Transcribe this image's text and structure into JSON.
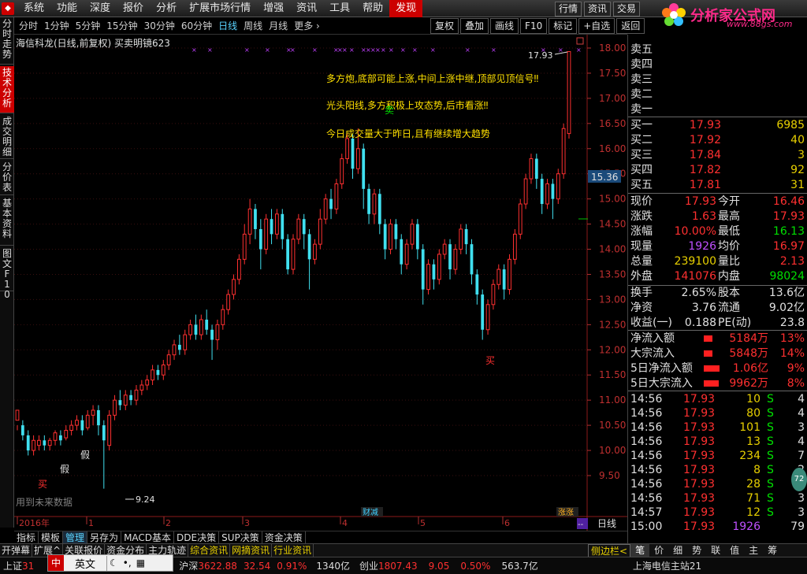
{
  "menu": {
    "items": [
      "系统",
      "功能",
      "深度",
      "报价",
      "分析",
      "扩展市场行情",
      "增强",
      "资讯",
      "工具",
      "帮助",
      "发现"
    ],
    "right_buttons": [
      "行情",
      "资讯",
      "交易"
    ]
  },
  "brand": {
    "name": "分析家公式网",
    "url": "www.88gs.com",
    "colors": {
      "accent": "#ff2a8a"
    }
  },
  "left_tabs": [
    "分时走势",
    "技术分析",
    "成交明细",
    "分价表",
    "基本资料",
    "图文F10"
  ],
  "chart_toolbar": {
    "periods": [
      "分时",
      "1分钟",
      "5分钟",
      "15分钟",
      "30分钟",
      "60分钟",
      "日线",
      "周线",
      "月线",
      "更多 ›"
    ],
    "tools": [
      "复权",
      "叠加",
      "画线",
      "F10",
      "标记",
      "+自选",
      "返回"
    ]
  },
  "chart_title": "海信科龙(日线,前复权) 买卖明镜623",
  "annotations": [
    "多方炮,底部可能上涨,中间上涨中继,顶部见顶信号‼",
    "光头阳线,多方积极上攻态势,后市看涨‼",
    "今日成交量大于昨日,且有继续增大趋势"
  ],
  "markers": {
    "buy": "买",
    "sell": "卖",
    "fake": "假",
    "cut": "财减",
    "limit": "涨涨",
    "hint": "用到未来数据",
    "low_label": "9.24",
    "high_label": "17.93",
    "cursor_price": "15.36",
    "period_label": "日线",
    "nav_minus": "--",
    "nav_plus": "+",
    "nav_minus2": "-",
    "nav_zero": "0"
  },
  "chart_data": {
    "type": "candlestick",
    "ylim": [
      9.24,
      18.0
    ],
    "y_ticks": [
      "18.00",
      "17.50",
      "17.00",
      "16.50",
      "16.00",
      "15.50",
      "15.00",
      "14.50",
      "14.00",
      "13.50",
      "13.00",
      "12.50",
      "12.00",
      "11.50",
      "11.00",
      "10.50",
      "10.00",
      "9.50"
    ],
    "x_ticks": [
      "2016年",
      "1",
      "2",
      "3",
      "4",
      "5",
      "6"
    ],
    "candles": [
      [
        10.6,
        10.8,
        10.5,
        10.4,
        10.9
      ],
      [
        10.5,
        10.3,
        10.2,
        10.6,
        10.4
      ],
      [
        10.3,
        10.0,
        9.9,
        10.4,
        9.95
      ],
      [
        10.0,
        10.2,
        9.9,
        10.3,
        10.1
      ],
      [
        10.1,
        10.2,
        10.0,
        10.3,
        10.15
      ],
      [
        10.2,
        10.1,
        10.0,
        10.3,
        10.05
      ],
      [
        10.1,
        10.2,
        10.0,
        10.25,
        10.15
      ],
      [
        10.2,
        10.35,
        10.1,
        10.4,
        10.3
      ],
      [
        10.3,
        10.2,
        10.1,
        10.4,
        10.25
      ],
      [
        10.25,
        10.4,
        10.2,
        10.5,
        10.35
      ],
      [
        10.4,
        10.5,
        10.3,
        10.6,
        10.45
      ],
      [
        10.5,
        10.6,
        10.4,
        10.7,
        10.55
      ],
      [
        10.6,
        10.4,
        10.3,
        10.7,
        10.45
      ],
      [
        10.45,
        10.7,
        10.4,
        10.8,
        10.6
      ],
      [
        10.7,
        10.8,
        10.5,
        10.9,
        10.7
      ],
      [
        10.8,
        10.5,
        10.3,
        10.9,
        10.4
      ],
      [
        10.5,
        10.2,
        9.24,
        10.6,
        10.3
      ],
      [
        10.1,
        10.7,
        10.0,
        10.8,
        10.6
      ],
      [
        10.7,
        11.0,
        10.6,
        11.1,
        10.9
      ],
      [
        11.0,
        10.9,
        10.8,
        11.2,
        10.95
      ],
      [
        10.9,
        11.1,
        10.8,
        11.2,
        11.05
      ],
      [
        11.1,
        11.0,
        10.9,
        11.2,
        11.05
      ],
      [
        11.0,
        11.2,
        10.9,
        11.3,
        11.1
      ],
      [
        11.2,
        11.3,
        11.1,
        11.4,
        11.25
      ],
      [
        11.3,
        11.4,
        11.2,
        11.5,
        11.35
      ],
      [
        11.4,
        11.6,
        11.3,
        11.7,
        11.5
      ],
      [
        11.6,
        11.5,
        11.4,
        11.7,
        11.55
      ],
      [
        11.5,
        11.7,
        11.4,
        11.8,
        11.65
      ],
      [
        11.7,
        11.9,
        11.6,
        12.0,
        11.8
      ],
      [
        11.9,
        12.1,
        11.8,
        12.2,
        12.0
      ],
      [
        12.1,
        12.0,
        11.9,
        12.3,
        12.05
      ],
      [
        12.0,
        12.3,
        11.9,
        12.4,
        12.2
      ],
      [
        12.3,
        12.5,
        12.2,
        12.6,
        12.4
      ],
      [
        12.5,
        12.3,
        12.2,
        12.7,
        12.4
      ],
      [
        12.3,
        12.6,
        12.2,
        12.7,
        12.5
      ],
      [
        12.6,
        12.4,
        12.3,
        12.8,
        12.5
      ],
      [
        12.4,
        12.2,
        11.8,
        12.5,
        12.1
      ],
      [
        12.2,
        12.5,
        12.0,
        12.6,
        12.4
      ],
      [
        12.5,
        12.8,
        12.4,
        12.9,
        12.7
      ],
      [
        12.8,
        13.1,
        12.7,
        13.2,
        13.0
      ],
      [
        13.1,
        13.4,
        13.0,
        13.5,
        13.3
      ],
      [
        13.4,
        13.8,
        13.3,
        13.9,
        13.6
      ],
      [
        13.8,
        14.3,
        13.7,
        14.5,
        14.1
      ],
      [
        14.3,
        14.8,
        14.1,
        15.0,
        14.6
      ],
      [
        14.8,
        14.4,
        14.2,
        14.9,
        14.5
      ],
      [
        14.4,
        14.0,
        13.6,
        14.6,
        13.8
      ],
      [
        14.0,
        14.6,
        13.9,
        14.7,
        14.4
      ],
      [
        14.6,
        14.3,
        14.1,
        14.8,
        14.4
      ],
      [
        14.3,
        14.7,
        14.2,
        14.8,
        14.5
      ],
      [
        14.7,
        14.2,
        14.0,
        14.8,
        14.3
      ],
      [
        14.2,
        13.6,
        13.5,
        14.3,
        13.7
      ],
      [
        13.6,
        14.2,
        13.5,
        14.3,
        14.0
      ],
      [
        14.2,
        14.6,
        14.1,
        14.7,
        14.4
      ],
      [
        14.6,
        14.3,
        14.0,
        14.7,
        14.2
      ],
      [
        14.3,
        13.8,
        13.2,
        14.4,
        13.6
      ],
      [
        13.8,
        14.1,
        13.7,
        14.2,
        14.0
      ],
      [
        14.1,
        14.6,
        14.0,
        14.8,
        14.4
      ],
      [
        14.6,
        15.0,
        14.5,
        15.1,
        14.8
      ],
      [
        15.0,
        14.8,
        14.6,
        15.2,
        14.9
      ],
      [
        14.8,
        15.3,
        14.7,
        15.4,
        15.1
      ],
      [
        15.3,
        15.8,
        15.2,
        15.9,
        15.6
      ],
      [
        15.8,
        16.2,
        15.7,
        16.3,
        16.0
      ],
      [
        16.2,
        15.6,
        15.4,
        16.3,
        15.7
      ],
      [
        15.6,
        16.0,
        15.5,
        16.4,
        15.9
      ],
      [
        16.0,
        15.2,
        14.8,
        16.1,
        15.1
      ],
      [
        15.2,
        14.7,
        14.5,
        15.3,
        14.6
      ],
      [
        14.7,
        15.1,
        14.5,
        15.2,
        14.9
      ],
      [
        15.1,
        14.5,
        14.3,
        15.2,
        14.4
      ],
      [
        14.5,
        14.0,
        13.8,
        14.6,
        13.9
      ],
      [
        14.0,
        14.5,
        13.9,
        14.6,
        14.3
      ],
      [
        14.5,
        14.2,
        14.0,
        14.6,
        14.3
      ],
      [
        14.2,
        13.7,
        13.5,
        14.3,
        13.6
      ],
      [
        13.7,
        14.1,
        13.6,
        14.2,
        14.0
      ],
      [
        14.1,
        14.5,
        14.0,
        14.6,
        14.3
      ],
      [
        14.5,
        14.0,
        13.8,
        14.6,
        13.9
      ],
      [
        14.0,
        13.2,
        12.9,
        14.1,
        13.1
      ],
      [
        13.2,
        13.7,
        13.1,
        13.8,
        13.5
      ],
      [
        13.7,
        13.4,
        13.2,
        13.8,
        13.5
      ],
      [
        13.4,
        13.9,
        13.3,
        14.0,
        13.7
      ],
      [
        13.9,
        14.1,
        13.8,
        14.2,
        14.0
      ],
      [
        14.1,
        13.6,
        13.4,
        14.2,
        13.7
      ],
      [
        13.6,
        14.0,
        13.5,
        14.1,
        13.9
      ],
      [
        14.0,
        14.4,
        13.9,
        14.5,
        14.2
      ],
      [
        14.4,
        14.1,
        13.9,
        14.5,
        14.2
      ],
      [
        14.1,
        13.5,
        13.3,
        14.2,
        13.4
      ],
      [
        13.5,
        13.1,
        12.9,
        13.6,
        13.0
      ],
      [
        13.1,
        12.4,
        12.2,
        13.2,
        12.5
      ],
      [
        12.4,
        12.9,
        12.3,
        13.0,
        12.7
      ],
      [
        12.9,
        13.3,
        12.8,
        13.4,
        13.1
      ],
      [
        13.3,
        13.6,
        13.2,
        13.7,
        13.5
      ],
      [
        13.6,
        13.2,
        13.0,
        13.7,
        13.3
      ],
      [
        13.2,
        13.8,
        13.1,
        13.9,
        13.6
      ],
      [
        13.8,
        14.3,
        13.7,
        14.4,
        14.1
      ],
      [
        14.3,
        14.9,
        14.2,
        15.0,
        14.7
      ],
      [
        14.9,
        15.4,
        14.8,
        15.5,
        15.2
      ],
      [
        15.4,
        15.8,
        15.3,
        15.9,
        15.6
      ],
      [
        15.8,
        15.4,
        15.2,
        15.9,
        15.5
      ],
      [
        15.4,
        14.9,
        14.7,
        15.5,
        14.8
      ],
      [
        14.9,
        15.3,
        14.8,
        15.4,
        15.1
      ],
      [
        15.3,
        15.0,
        14.6,
        15.4,
        14.8
      ],
      [
        15.0,
        15.5,
        14.9,
        15.6,
        15.3
      ],
      [
        15.5,
        16.4,
        15.4,
        16.5,
        16.1
      ],
      [
        16.3,
        17.93,
        16.2,
        17.93,
        17.4
      ]
    ],
    "candle_format": "[open, close, low, high, aux]"
  },
  "quote": {
    "sell": [
      {
        "label": "卖五",
        "price": "",
        "vol": ""
      },
      {
        "label": "卖四",
        "price": "",
        "vol": ""
      },
      {
        "label": "卖三",
        "price": "",
        "vol": ""
      },
      {
        "label": "卖二",
        "price": "",
        "vol": ""
      },
      {
        "label": "卖一",
        "price": "",
        "vol": ""
      }
    ],
    "buy": [
      {
        "label": "买一",
        "price": "17.93",
        "vol": "6985"
      },
      {
        "label": "买二",
        "price": "17.92",
        "vol": "40"
      },
      {
        "label": "买三",
        "price": "17.84",
        "vol": "3"
      },
      {
        "label": "买四",
        "price": "17.82",
        "vol": "92"
      },
      {
        "label": "买五",
        "price": "17.81",
        "vol": "31"
      }
    ],
    "stats": [
      {
        "l1": "现价",
        "v1": "17.93",
        "c1": "red",
        "l2": "今开",
        "v2": "16.46",
        "c2": "red"
      },
      {
        "l1": "涨跌",
        "v1": "1.63",
        "c1": "red",
        "l2": "最高",
        "v2": "17.93",
        "c2": "red"
      },
      {
        "l1": "涨幅",
        "v1": "10.00%",
        "c1": "red",
        "l2": "最低",
        "v2": "16.13",
        "c2": "grn"
      },
      {
        "l1": "现量",
        "v1": "1926",
        "c1": "pur",
        "l2": "均价",
        "v2": "16.97",
        "c2": "red"
      },
      {
        "l1": "总量",
        "v1": "239100",
        "c1": "yel",
        "l2": "量比",
        "v2": "2.13",
        "c2": "red"
      },
      {
        "l1": "外盘",
        "v1": "141076",
        "c1": "red",
        "l2": "内盘",
        "v2": "98024",
        "c2": "grn"
      }
    ],
    "info": [
      {
        "l1": "换手",
        "v1": "2.65%",
        "l2": "股本",
        "v2": "13.6亿"
      },
      {
        "l1": "净资",
        "v1": "3.76",
        "l2": "流通",
        "v2": "9.02亿"
      },
      {
        "l1": "收益(一)",
        "v1": "0.188",
        "l2": "PE(动)",
        "v2": "23.8"
      }
    ],
    "flows": [
      {
        "label": "净流入额",
        "value": "5184万",
        "pct": "13%",
        "bar": 0.22
      },
      {
        "label": "大宗流入",
        "value": "5848万",
        "pct": "14%",
        "bar": 0.22
      },
      {
        "label": "5日净流入额",
        "value": "1.06亿",
        "pct": "9%",
        "bar": 0.6
      },
      {
        "label": "5日大宗流入",
        "value": "9962万",
        "pct": "8%",
        "bar": 0.55
      }
    ],
    "ticks": [
      {
        "t": "14:56",
        "p": "17.93",
        "v": "10",
        "s": "S",
        "n": "4"
      },
      {
        "t": "14:56",
        "p": "17.93",
        "v": "80",
        "s": "S",
        "n": "4"
      },
      {
        "t": "14:56",
        "p": "17.93",
        "v": "101",
        "s": "S",
        "n": "3"
      },
      {
        "t": "14:56",
        "p": "17.93",
        "v": "13",
        "s": "S",
        "n": "4"
      },
      {
        "t": "14:56",
        "p": "17.93",
        "v": "234",
        "s": "S",
        "n": "7"
      },
      {
        "t": "14:56",
        "p": "17.93",
        "v": "8",
        "s": "S",
        "n": "2"
      },
      {
        "t": "14:56",
        "p": "17.93",
        "v": "28",
        "s": "S",
        "n": "3"
      },
      {
        "t": "14:56",
        "p": "17.93",
        "v": "71",
        "s": "S",
        "n": "3"
      },
      {
        "t": "14:57",
        "p": "17.93",
        "v": "12",
        "s": "S",
        "n": "3"
      },
      {
        "t": "15:00",
        "p": "17.93",
        "v": "1926",
        "s": "",
        "n": "79"
      }
    ]
  },
  "bottom_tabs": [
    "指标",
    "模板",
    "管理",
    "另存为",
    "MACD基本",
    "DDE决策",
    "SUP决策",
    "资金决策"
  ],
  "bottom_left_tabs": [
    "开弹幕",
    "扩展^",
    "关联报价",
    "资金分布",
    "主力轨迹",
    "综合资讯",
    "网摘资讯",
    "行业资讯"
  ],
  "bottom_right_tabs": [
    "侧边栏<",
    "笔",
    "价",
    "细",
    "势",
    "联",
    "值",
    "主",
    "筹"
  ],
  "status": {
    "idx1_name": "上证",
    "idx1_val": "31",
    "ime_text": "英文",
    "idx2_name": "沪深",
    "idx2_val": "3622.88",
    "idx2_chg": "32.54",
    "idx2_pct": "0.91%",
    "idx2_vol": "1340亿",
    "idx3_name": "创业",
    "idx3_val": "1807.43",
    "idx3_chg": "9.05",
    "idx3_pct": "0.50%",
    "idx3_vol": "563.7亿",
    "server": "上海电信主站21"
  }
}
